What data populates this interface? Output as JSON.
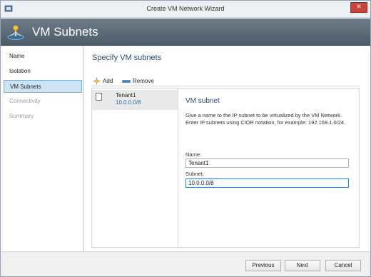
{
  "window": {
    "title": "Create VM Network Wizard",
    "close_glyph": "✕"
  },
  "header": {
    "title": "VM Subnets",
    "icon": "network-icon"
  },
  "steps": [
    {
      "label": "Name",
      "state": "normal"
    },
    {
      "label": "Isolation",
      "state": "normal"
    },
    {
      "label": "VM Subnets",
      "state": "active"
    },
    {
      "label": "Connectivity",
      "state": "disabled"
    },
    {
      "label": "Summary",
      "state": "disabled"
    }
  ],
  "main": {
    "section_title": "Specify VM subnets",
    "toolbar": {
      "add_label": "Add",
      "remove_label": "Remove"
    },
    "subnets": [
      {
        "name": "Tenant1",
        "subnet": "10.0.0.0/8"
      }
    ],
    "details": {
      "title": "VM subnet",
      "description": "Give a name to the IP subnet to be virtualized by the VM Network. Enter IP subnets using CIDR notation, for example: 192.168.1.0/24.",
      "name_label": "Name:",
      "name_value": "Tenant1",
      "subnet_label": "Subnet:",
      "subnet_value": "10.0.0.0/8"
    }
  },
  "footer": {
    "previous_label": "Previous",
    "next_label": "Next",
    "cancel_label": "Cancel"
  },
  "colors": {
    "header_bg": "#5d6a77",
    "active_step_bg": "#cde4f7",
    "link_blue": "#2a6fb0",
    "close_red": "#c7453a"
  }
}
